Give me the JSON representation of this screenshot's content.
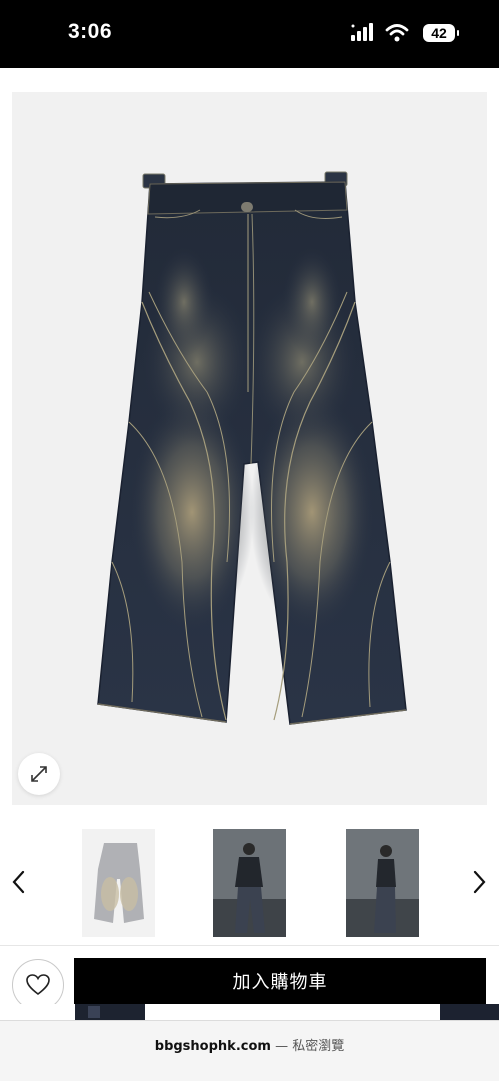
{
  "status_bar": {
    "time": "3:06",
    "battery": "42",
    "icons": [
      "signal-icon",
      "wifi-icon",
      "battery-icon"
    ]
  },
  "product": {
    "image": "wide-leg-distressed-denim-jeans",
    "zoom_icon": "expand-icon"
  },
  "thumbnails": [
    {
      "name": "jeans-front-thumbnail",
      "selected": true
    },
    {
      "name": "model-front-thumbnail",
      "selected": false
    },
    {
      "name": "model-side-thumbnail",
      "selected": false
    }
  ],
  "actions": {
    "wishlist_icon": "heart-icon",
    "add_to_cart": "加入購物車"
  },
  "browser": {
    "domain": "bbgshophk.com",
    "separator": "—",
    "mode": "私密瀏覽"
  },
  "colors": {
    "status_bg": "#000000",
    "cart_button": "#000000",
    "denim": "#27303f"
  }
}
